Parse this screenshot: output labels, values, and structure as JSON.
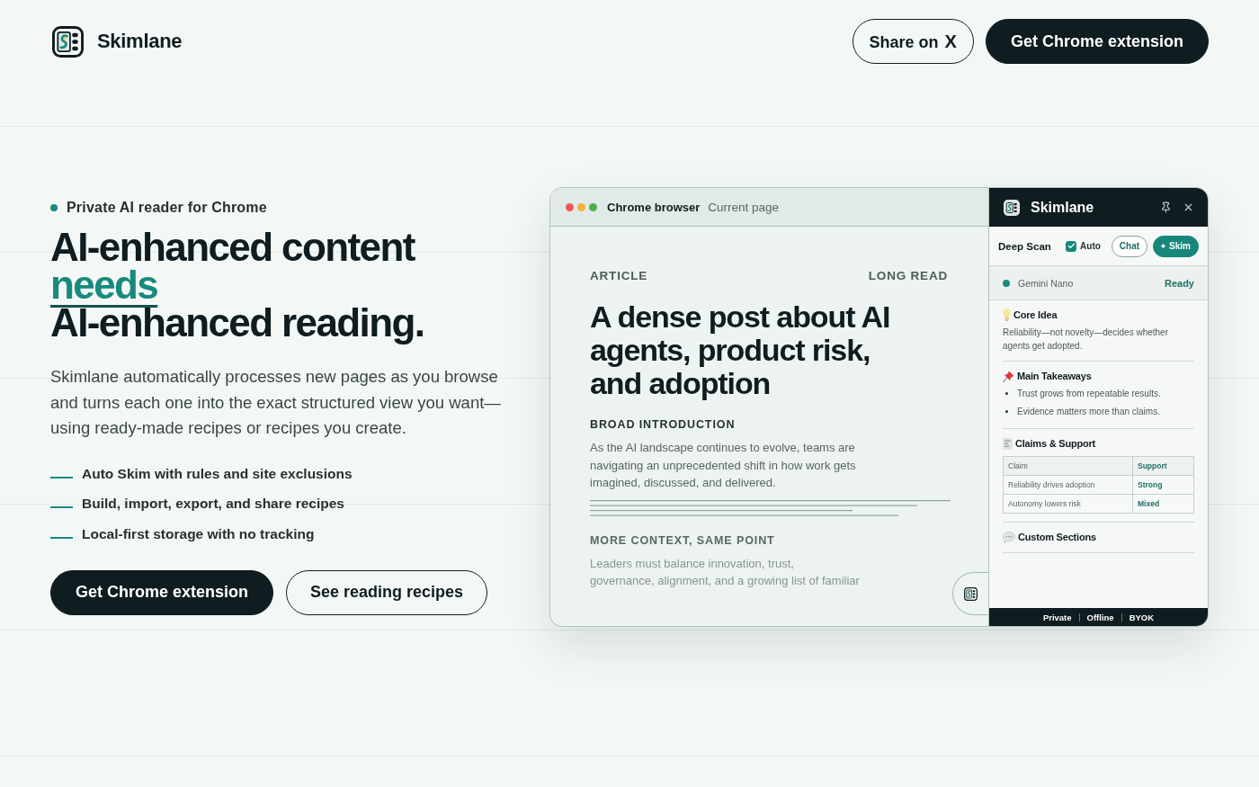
{
  "header": {
    "brand": "Skimlane",
    "buttons": [
      {
        "label": "Share on **X**",
        "kind": "outline"
      },
      {
        "label": "Get Chrome extension",
        "kind": "solid"
      }
    ]
  },
  "hero": {
    "eyebrow": "Private AI reader for Chrome",
    "heading": {
      "line_1": "AI-enhanced content",
      "highlight": "needs",
      "line_3": "AI-enhanced reading."
    },
    "description": "Skimlane automatically processes new pages as you browse and turns each one into the exact structured view you want—using ready-made recipes or recipes you create.",
    "features": [
      "Auto Skim with rules and site exclusions",
      "Build, import, export, and share recipes",
      "Local-first storage with no tracking"
    ],
    "buttons": [
      {
        "label": "Get Chrome extension",
        "kind": "solid"
      },
      {
        "label": "See reading recipes",
        "kind": "outline"
      }
    ]
  },
  "browser": {
    "title": "Chrome browser",
    "subtitle": "Current page",
    "article": {
      "label": "ARTICLE",
      "tag": "LONG READ",
      "title": "A dense post about AI agents, product risk, and adoption",
      "sections": [
        {
          "kind": "lead",
          "heading": "BROAD INTRODUCTION",
          "lines": [
            "As the AI landscape continues to evolve, teams are",
            "navigating an unprecedented shift in how work gets",
            "imagined, discussed, and delivered."
          ]
        },
        {
          "kind": "faded",
          "heading": "MORE CONTEXT, SAME POINT",
          "lines": [
            "Leaders must balance innovation, trust,",
            "governance, alignment, and a growing list of familiar"
          ]
        }
      ]
    }
  },
  "panel": {
    "brand": "Skimlane",
    "toolbar": {
      "label": "Deep Scan",
      "auto": {
        "label": "Auto",
        "checked": true
      },
      "buttons": [
        {
          "label": "Chat",
          "kind": "outline"
        },
        {
          "label": "Skim",
          "kind": "primary"
        }
      ]
    },
    "status": {
      "model": "Gemini Nano",
      "state": "Ready"
    },
    "sections": [
      {
        "kind": "text",
        "title": "Core Idea",
        "text": "Reliability—not novelty—decides whether agents get adopted."
      },
      {
        "kind": "list",
        "title": "Main Takeaways",
        "items": [
          "Trust grows from repeatable results.",
          "Evidence matters more than claims."
        ]
      },
      {
        "kind": "table",
        "title": "Claims & Support",
        "columns": [
          "Claim",
          "Support"
        ],
        "rows": [
          [
            "Reliability drives adoption",
            "Strong"
          ],
          [
            "Autonomy lowers risk",
            "Mixed"
          ]
        ]
      },
      {
        "kind": "custom",
        "title": "Custom Sections"
      }
    ],
    "footer": [
      "Private",
      "Offline",
      "BYOK"
    ]
  }
}
